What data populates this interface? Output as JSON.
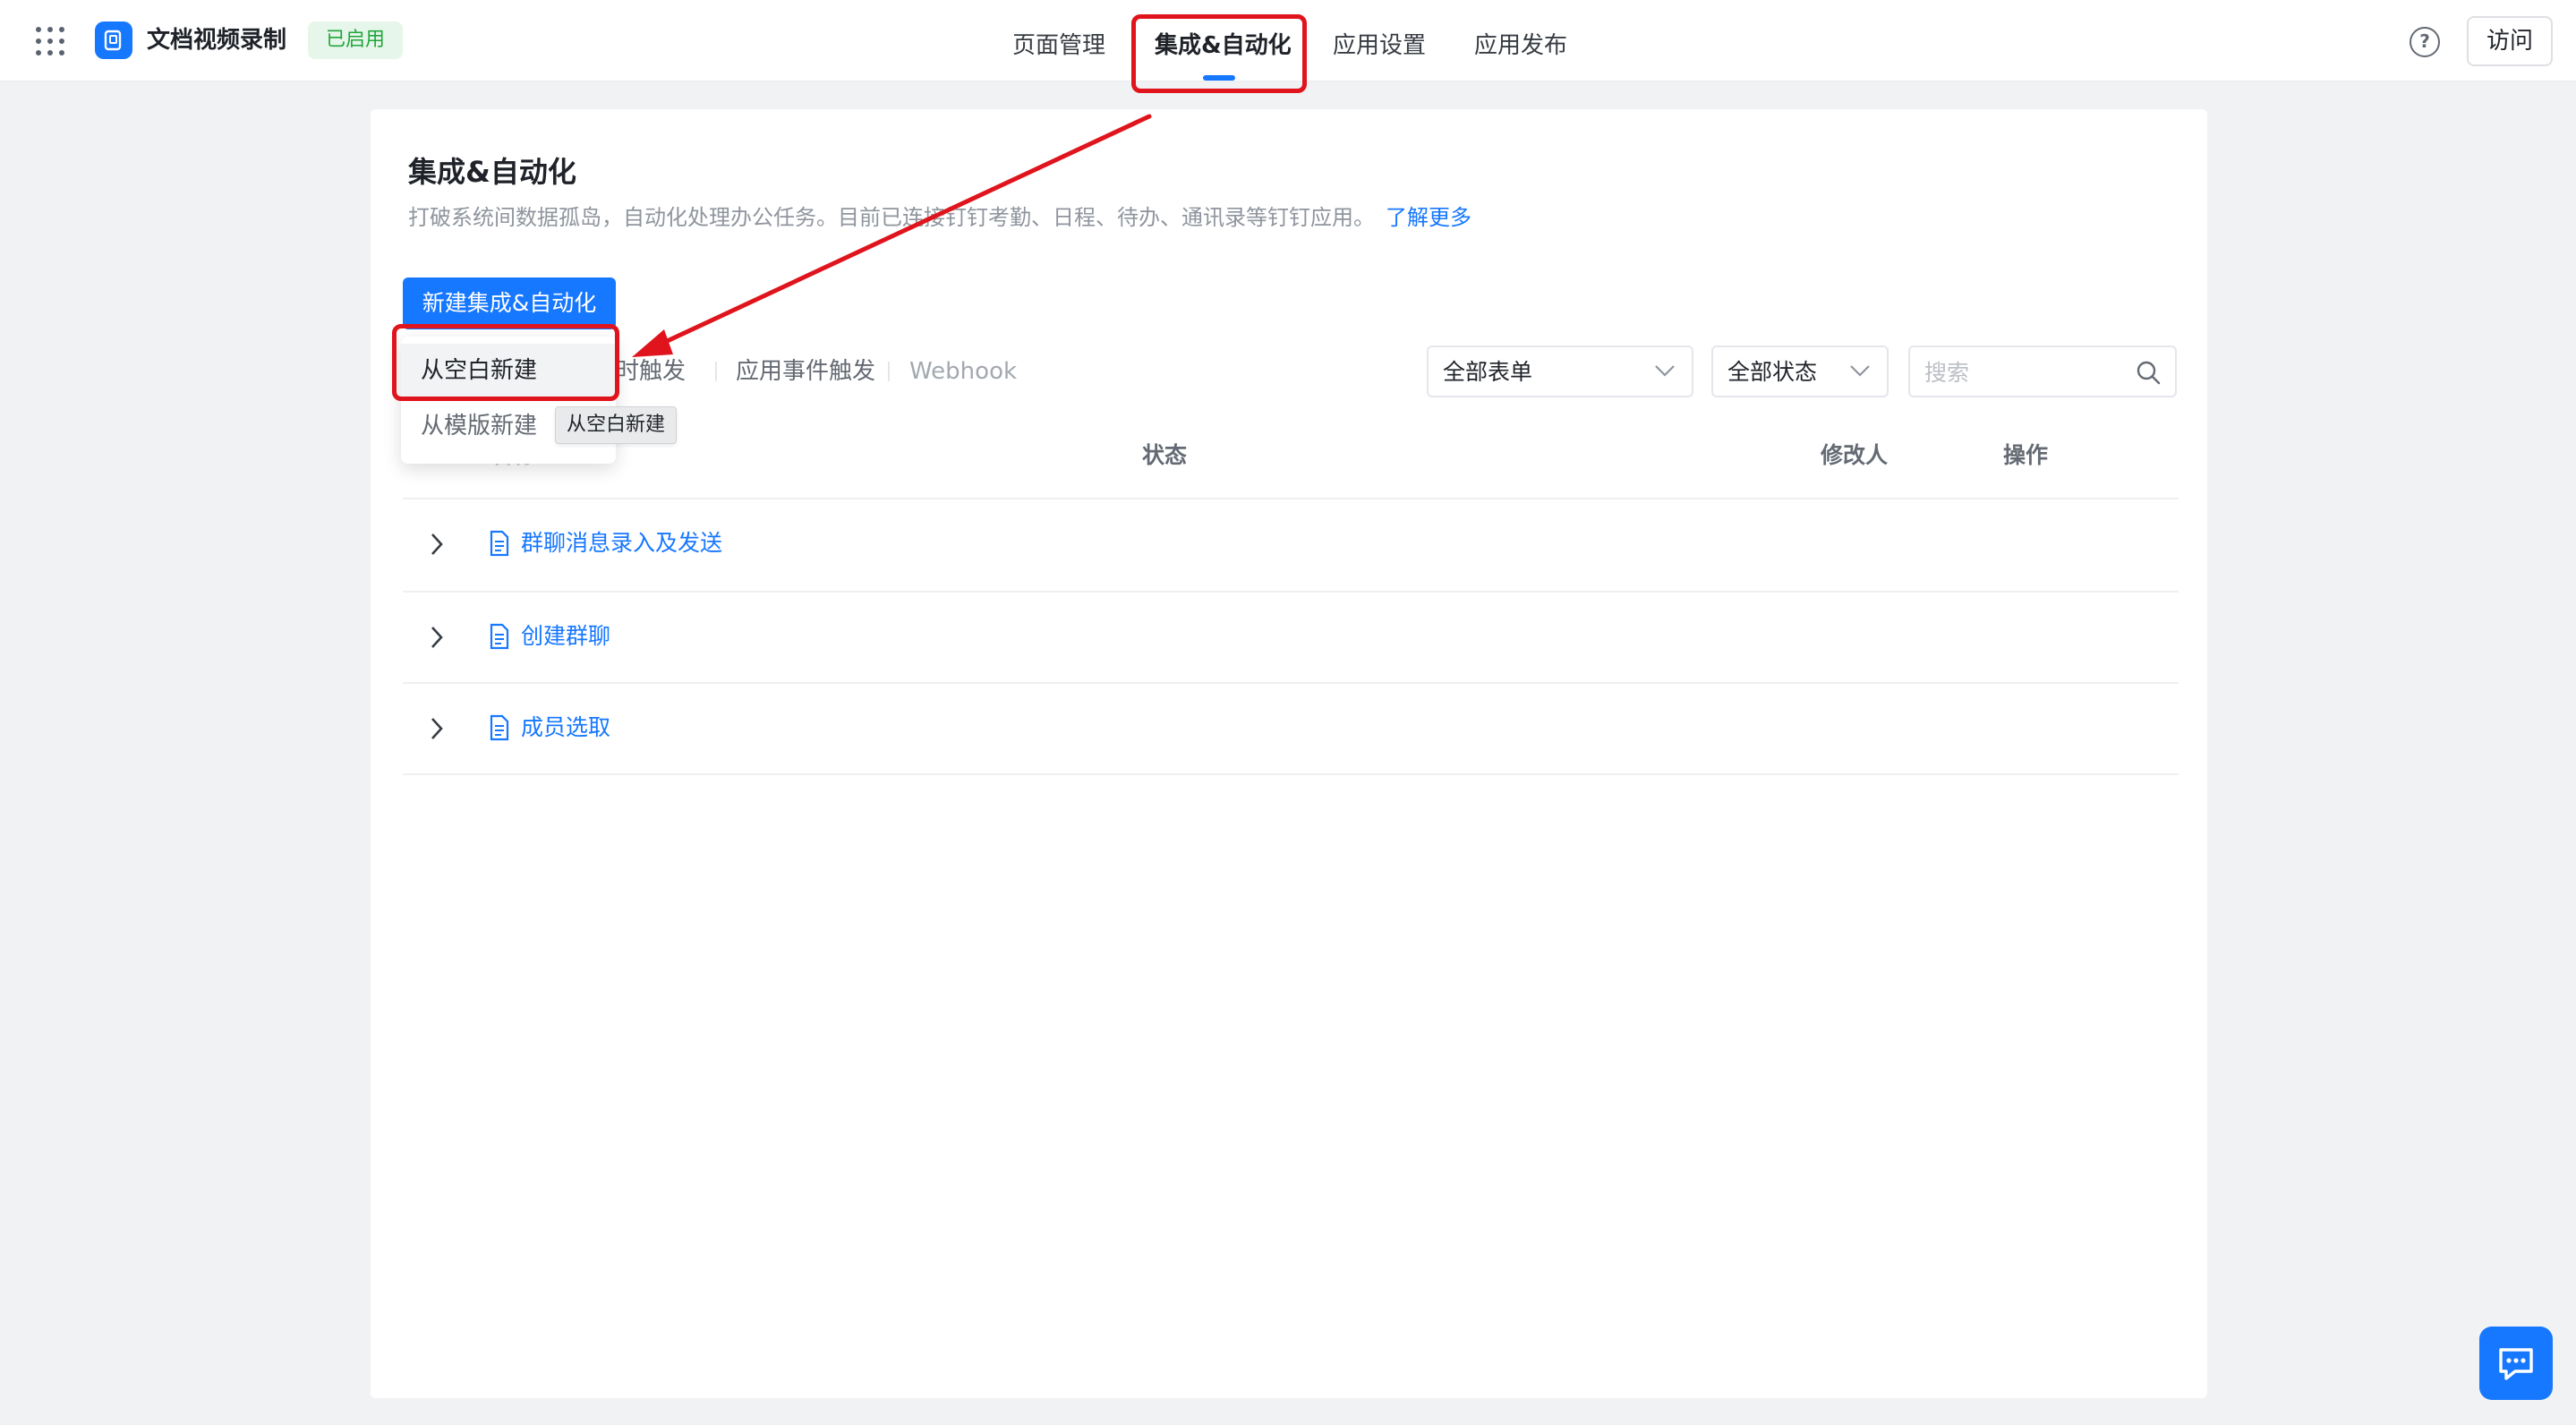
{
  "header": {
    "app_name": "文档视频录制",
    "status": "已启用",
    "tabs": [
      {
        "label": "页面管理"
      },
      {
        "label": "集成&自动化"
      },
      {
        "label": "应用设置"
      },
      {
        "label": "应用发布"
      }
    ],
    "help_icon": "?",
    "visit_label": "访问"
  },
  "page": {
    "title": "集成&自动化",
    "description": "打破系统间数据孤岛，自动化处理办公任务。目前已连接钉钉考勤、日程、待办、通讯录等钉钉应用。",
    "learn_more": "了解更多",
    "new_button": "新建集成&自动化"
  },
  "filters": {
    "tabs": [
      {
        "label": "定时触发"
      },
      {
        "label": "应用事件触发"
      },
      {
        "label": "Webhook"
      }
    ],
    "form_select": "全部表单",
    "status_select": "全部状态",
    "search_placeholder": "搜索"
  },
  "table": {
    "headers": {
      "name": "名称",
      "status": "状态",
      "modifier": "修改人",
      "actions": "操作"
    },
    "rows": [
      {
        "name": "群聊消息录入及发送"
      },
      {
        "name": "创建群聊"
      },
      {
        "name": "成员选取"
      }
    ]
  },
  "dropdown": {
    "items": [
      {
        "label": "从空白新建"
      },
      {
        "label": "从模版新建"
      }
    ],
    "tooltip": "从空白新建"
  },
  "colors": {
    "primary": "#1677ff",
    "annotation": "#e0141c",
    "enabled_green": "#20a63d"
  },
  "icons": [
    "apps-grid-icon",
    "app-logo-icon",
    "help-icon",
    "chevron-down-icon",
    "search-icon",
    "chevron-right-icon",
    "document-icon",
    "chat-icon"
  ]
}
